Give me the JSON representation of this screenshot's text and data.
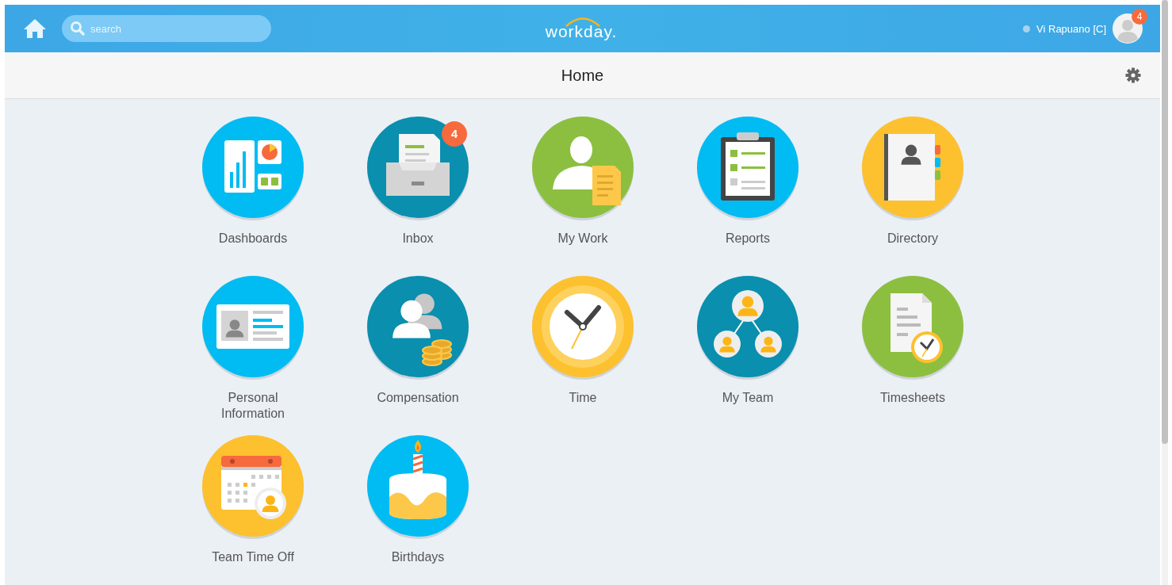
{
  "header": {
    "search": {
      "placeholder": "search"
    },
    "logo": "workday.",
    "user": {
      "name": "Vi Rapuano [C]",
      "notifications": "4"
    }
  },
  "title_bar": {
    "title": "Home"
  },
  "apps": [
    {
      "label": "Dashboards",
      "kind": "dashboards"
    },
    {
      "label": "Inbox",
      "kind": "inbox",
      "badge": "4"
    },
    {
      "label": "My Work",
      "kind": "mywork"
    },
    {
      "label": "Reports",
      "kind": "reports"
    },
    {
      "label": "Directory",
      "kind": "directory"
    },
    {
      "label": "Personal Information",
      "kind": "personal"
    },
    {
      "label": "Compensation",
      "kind": "compensation"
    },
    {
      "label": "Time",
      "kind": "time"
    },
    {
      "label": "My Team",
      "kind": "team"
    },
    {
      "label": "Timesheets",
      "kind": "timesheets"
    },
    {
      "label": "Team Time Off",
      "kind": "timeoff"
    },
    {
      "label": "Birthdays",
      "kind": "birthdays"
    }
  ]
}
